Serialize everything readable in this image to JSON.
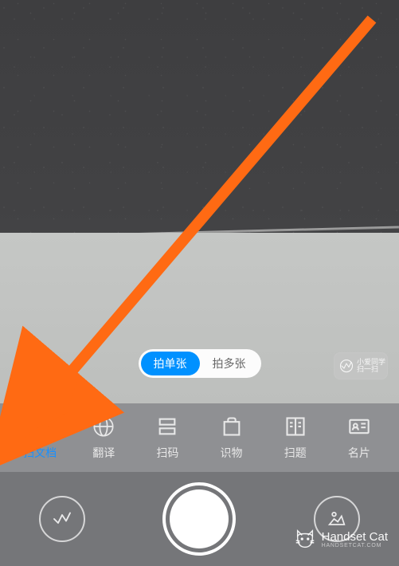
{
  "pill_toggle": {
    "options": [
      {
        "label": "拍单张",
        "active": true
      },
      {
        "label": "拍多张",
        "active": false
      }
    ]
  },
  "xiaoai": {
    "line1": "小爱同学",
    "line2": "扫一扫"
  },
  "modes": [
    {
      "id": "document",
      "label": "扫文档",
      "icon": "document-icon",
      "active": true
    },
    {
      "id": "translate",
      "label": "翻译",
      "icon": "globe-icon",
      "active": false
    },
    {
      "id": "scan",
      "label": "扫码",
      "icon": "scan-icon",
      "active": false
    },
    {
      "id": "identify",
      "label": "识物",
      "icon": "bag-icon",
      "active": false
    },
    {
      "id": "question",
      "label": "扫题",
      "icon": "book-icon",
      "active": false
    },
    {
      "id": "card",
      "label": "名片",
      "icon": "card-icon",
      "active": false
    }
  ],
  "watermark": {
    "title": "Handset Cat",
    "subtitle": "HANDSETCAT.COM"
  },
  "colors": {
    "accent": "#0091ff",
    "mode_bar": "#8f9093",
    "bottom_bar": "#757679",
    "arrow": "#ff6a13"
  }
}
